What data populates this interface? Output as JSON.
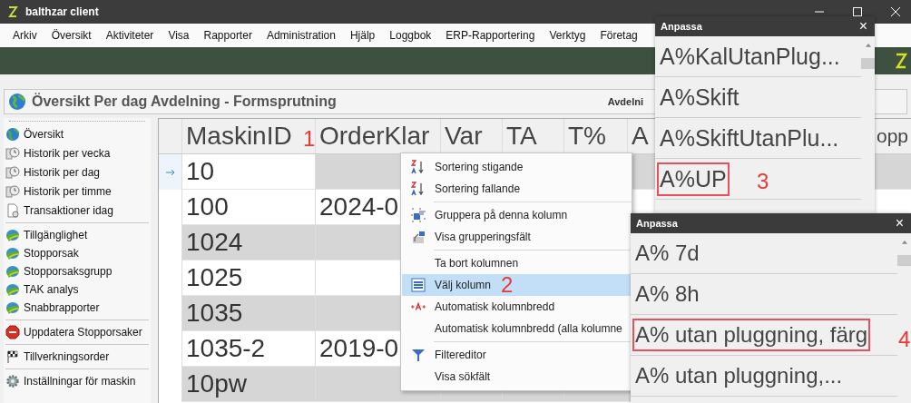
{
  "window": {
    "title": "balthzar client"
  },
  "menu_bar": [
    "Arkiv",
    "Översikt",
    "Aktiviteter",
    "Visa",
    "Rapporter",
    "Administration",
    "Hjälp",
    "Loggbok",
    "ERP-Rapportering",
    "Verktyg",
    "Företag"
  ],
  "page_header": {
    "title": "Översikt Per dag Avdelning - Formsprutning",
    "filter_label": "Avdelni"
  },
  "sidebar": {
    "groups": [
      {
        "items": [
          {
            "label": "Översikt"
          },
          {
            "label": "Historik per vecka"
          },
          {
            "label": "Historik per dag"
          },
          {
            "label": "Historik per timme"
          },
          {
            "label": "Transaktioner idag"
          }
        ]
      },
      {
        "items": [
          {
            "label": "Tillgänglighet"
          },
          {
            "label": "Stopporsak"
          },
          {
            "label": "Stopporsaksgrupp"
          },
          {
            "label": "TAK analys"
          },
          {
            "label": "Snabbrapporter"
          }
        ]
      },
      {
        "items": [
          {
            "label": "Uppdatera Stopporsaker"
          }
        ]
      },
      {
        "items": [
          {
            "label": "Tillverkningsorder"
          }
        ]
      },
      {
        "items": [
          {
            "label": "Inställningar för maskin"
          }
        ]
      }
    ]
  },
  "grid": {
    "columns": [
      "MaskinID",
      "OrderKlar",
      "Var",
      "TA",
      "T%",
      "A",
      "opp"
    ],
    "rows": [
      {
        "current": true,
        "cells": [
          "10"
        ]
      },
      {
        "current": false,
        "cells": [
          "100",
          "2024-0"
        ]
      },
      {
        "current": false,
        "cells": [
          "1024"
        ]
      },
      {
        "current": false,
        "cells": [
          "1025"
        ]
      },
      {
        "current": false,
        "cells": [
          "1035"
        ]
      },
      {
        "current": false,
        "cells": [
          "1035-2",
          "2019-0"
        ]
      },
      {
        "current": false,
        "cells": [
          "10pw"
        ]
      }
    ]
  },
  "context_menu": {
    "groups": [
      {
        "items": [
          {
            "label": "Sortering stigande",
            "selected": false
          },
          {
            "label": "Sortering fallande",
            "selected": false
          }
        ]
      },
      {
        "items": [
          {
            "label": "Gruppera på denna kolumn",
            "selected": false
          },
          {
            "label": "Visa grupperingsfält",
            "selected": false
          }
        ]
      },
      {
        "items": [
          {
            "label": "Ta bort kolumnen",
            "selected": false
          },
          {
            "label": "Välj kolumn",
            "selected": true
          },
          {
            "label": "Automatisk kolumnbredd",
            "selected": false
          },
          {
            "label": "Automatisk kolumnbredd (alla kolumne",
            "selected": false
          }
        ]
      },
      {
        "items": [
          {
            "label": "Filtereditor",
            "selected": false
          },
          {
            "label": "Visa sökfält",
            "selected": false
          }
        ]
      }
    ]
  },
  "dialogs": [
    {
      "title": "Anpassa",
      "close": "×",
      "items": [
        {
          "label": "A%KalUtanPlug...",
          "marked": false
        },
        {
          "label": "A%Skift",
          "marked": false
        },
        {
          "label": "A%SkiftUtanPlu...",
          "marked": false
        },
        {
          "label": "A%UP",
          "marked": true
        }
      ]
    },
    {
      "title": "Anpassa",
      "close": "×",
      "items": [
        {
          "label": "A% 7d",
          "marked": false
        },
        {
          "label": "A% 8h",
          "marked": false
        },
        {
          "label": "A% utan pluggning, färg",
          "marked": true
        },
        {
          "label": "A% utan pluggning,...",
          "marked": false
        }
      ]
    }
  ],
  "annotations": [
    "1",
    "2",
    "3",
    "4"
  ]
}
